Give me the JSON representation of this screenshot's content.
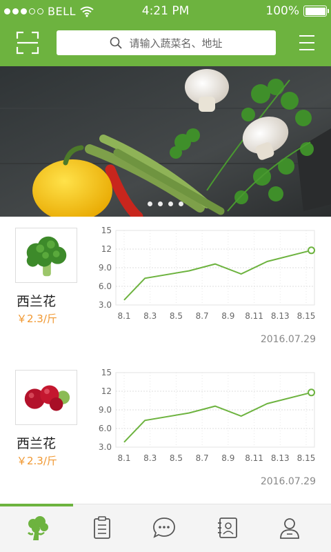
{
  "status_bar": {
    "carrier": "BELL",
    "time": "4:21 PM",
    "battery": "100%"
  },
  "header": {
    "search_placeholder": "请输入蔬菜名、地址",
    "accent_color": "#6db33f",
    "left_icon": "scan-icon",
    "right_icon": "menu-icon"
  },
  "banner": {
    "slide_count": 4
  },
  "cards": [
    {
      "name": "西兰花",
      "price": "￥2.3/斤",
      "image": "broccoli",
      "date": "2016.07.29",
      "chart_data": {
        "type": "line",
        "categories": [
          "8.1",
          "8.3",
          "8.5",
          "8.7",
          "8.9",
          "8.11",
          "8.13",
          "8.15"
        ],
        "values": [
          3.8,
          7.3,
          8.5,
          9.6,
          8.0,
          10.0,
          11.8
        ],
        "x_positions": [
          0,
          0.8,
          2.5,
          3.5,
          4.5,
          5.5,
          7.2
        ],
        "y_ticks": [
          "15",
          "12",
          "9.0",
          "6.0",
          "3.0"
        ],
        "ylim": [
          3,
          15
        ],
        "grid": true,
        "line_color": "#6db33f"
      }
    },
    {
      "name": "西兰花",
      "price": "￥2.3/斤",
      "image": "cranberries",
      "date": "2016.07.29",
      "chart_data": {
        "type": "line",
        "categories": [
          "8.1",
          "8.3",
          "8.5",
          "8.7",
          "8.9",
          "8.11",
          "8.13",
          "8.15"
        ],
        "values": [
          3.8,
          7.3,
          8.5,
          9.6,
          8.0,
          10.0,
          11.8
        ],
        "x_positions": [
          0,
          0.8,
          2.5,
          3.5,
          4.5,
          5.5,
          7.2
        ],
        "y_ticks": [
          "15",
          "12",
          "9.0",
          "6.0",
          "3.0"
        ],
        "ylim": [
          3,
          15
        ],
        "grid": true,
        "line_color": "#6db33f"
      }
    }
  ],
  "tabbar": {
    "active_index": 0,
    "tabs": [
      {
        "icon": "vegetable-icon"
      },
      {
        "icon": "list-icon"
      },
      {
        "icon": "chat-icon"
      },
      {
        "icon": "contacts-icon"
      },
      {
        "icon": "profile-icon"
      }
    ]
  }
}
